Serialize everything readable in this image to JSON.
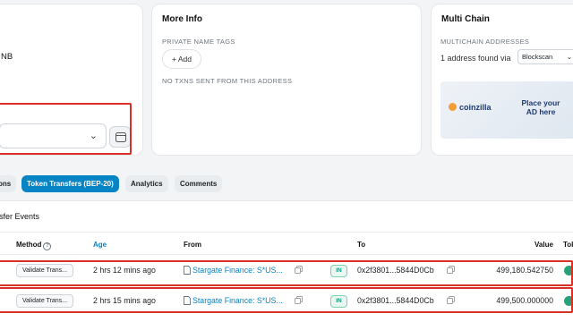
{
  "overview": {
    "bnb_text": "NB"
  },
  "more_info": {
    "title": "More Info",
    "private_tags_label": "PRIVATE NAME TAGS",
    "add_label": "+ Add",
    "no_txns": "NO TXNS SENT FROM THIS ADDRESS"
  },
  "multi_chain": {
    "title": "Multi Chain",
    "addresses_label": "MULTICHAIN ADDRESSES",
    "found_text": "1 address found via",
    "explorer_select": "Blockscan",
    "ad": {
      "logo_text": "coinzilla",
      "promo_line1": "Place your",
      "promo_line2": "AD here"
    }
  },
  "tabs": [
    {
      "label": "ons",
      "active": false
    },
    {
      "label": "Token Transfers (BEP-20)",
      "active": true
    },
    {
      "label": "Analytics",
      "active": false
    },
    {
      "label": "Comments",
      "active": false
    }
  ],
  "events": {
    "title": "nsfer Events",
    "headers": {
      "method": "Method",
      "age": "Age",
      "from": "From",
      "to": "To",
      "value": "Value",
      "token": "Tok"
    },
    "rows": [
      {
        "method": "Validate Trans...",
        "age": "2 hrs 12 mins ago",
        "from": "Stargate Finance: S*US...",
        "direction": "IN",
        "to": "0x2f3801...5844D0Cb",
        "value": "499,180.542750"
      },
      {
        "method": "Validate Trans...",
        "age": "2 hrs 15 mins ago",
        "from": "Stargate Finance: S*US...",
        "direction": "IN",
        "to": "0x2f3801...5844D0Cb",
        "value": "499,500.000000"
      }
    ]
  },
  "colors": {
    "accent": "#0784c3",
    "highlight": "#d93025",
    "in_badge": "#00a186"
  }
}
